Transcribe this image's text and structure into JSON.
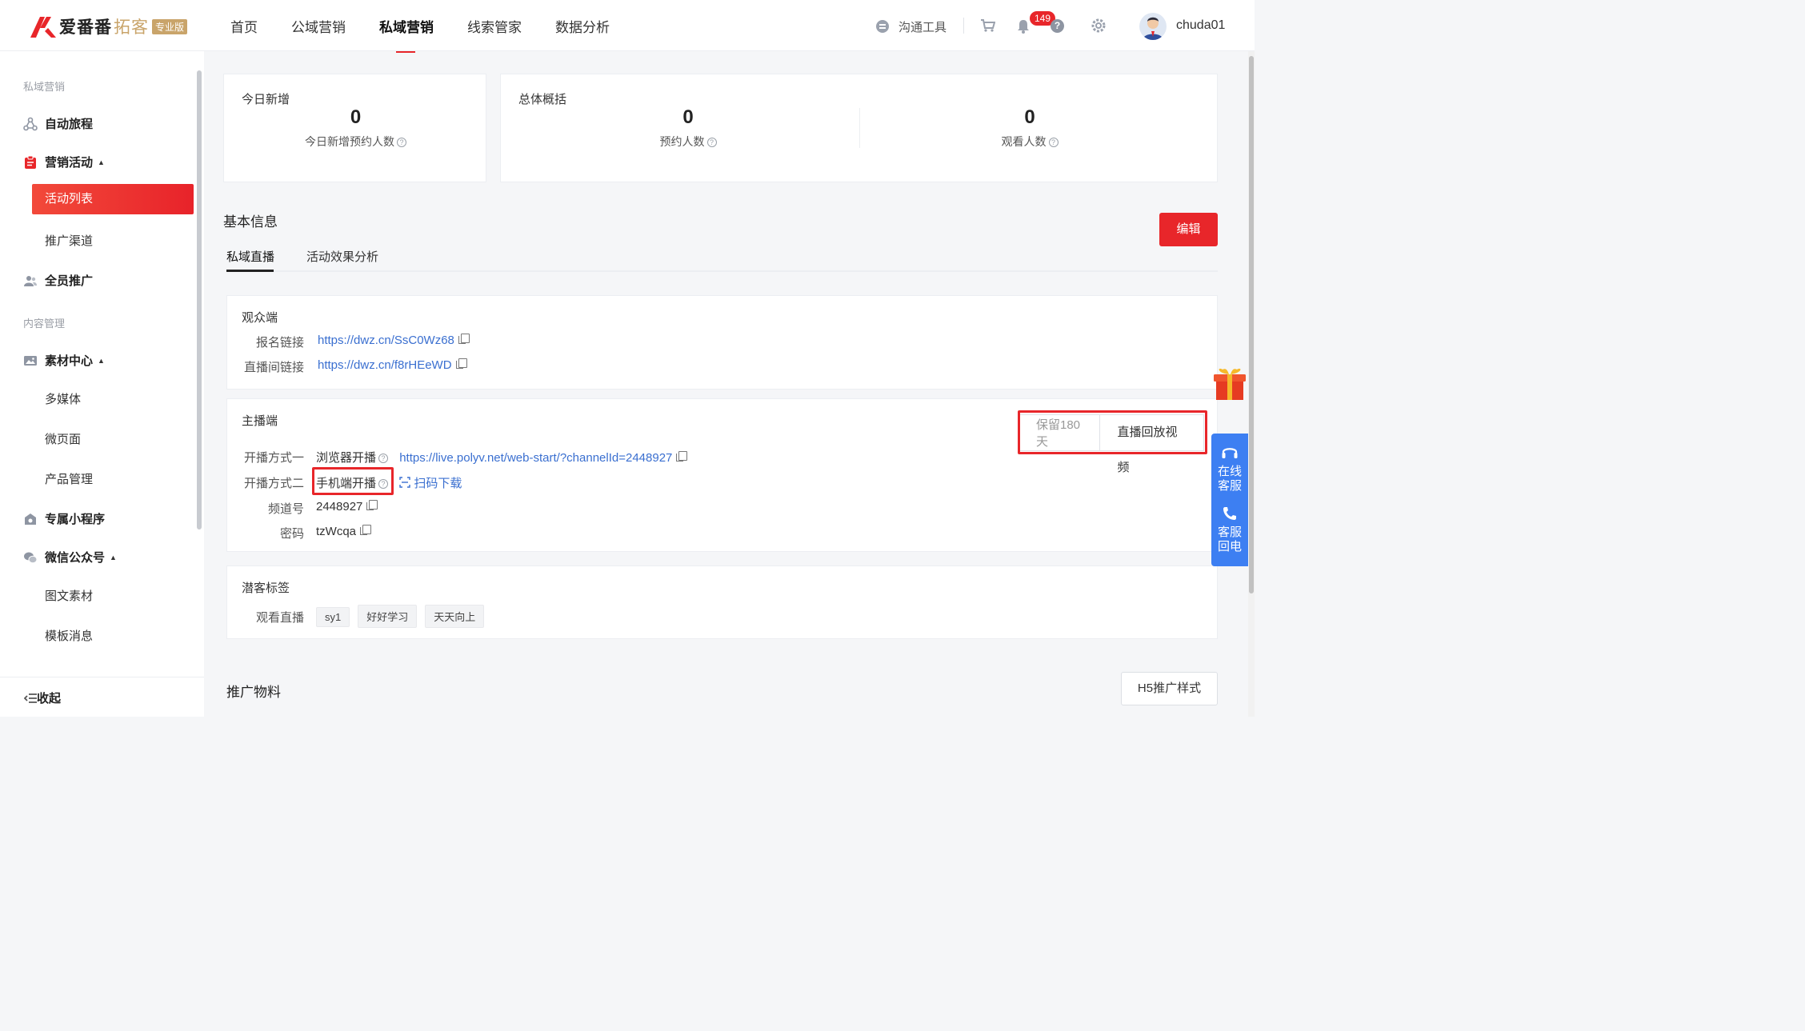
{
  "header": {
    "brand": "爱番番",
    "brand_sub": "拓客",
    "pro_badge": "专业版",
    "nav": [
      "首页",
      "公域营销",
      "私域营销",
      "线索管家",
      "数据分析"
    ],
    "active_nav": "私域营销",
    "tool_label": "沟通工具",
    "notification_count": "149",
    "username": "chuda01"
  },
  "sidebar": {
    "section_private": "私域营销",
    "auto_journey": "自动旅程",
    "marketing_activity": "营销活动",
    "activity_list": "活动列表",
    "promo_channel": "推广渠道",
    "all_staff": "全员推广",
    "section_content": "内容管理",
    "material_center": "素材中心",
    "multimedia": "多媒体",
    "micro_page": "微页面",
    "product_mgmt": "产品管理",
    "mini_program": "专属小程序",
    "wechat_official": "微信公众号",
    "article_material": "图文素材",
    "template_msg": "模板消息",
    "collapse": "收起"
  },
  "main": {
    "today_card": {
      "title": "今日新增",
      "value": "0",
      "label": "今日新增预约人数"
    },
    "overview_card": {
      "title": "总体概括",
      "reserve_value": "0",
      "reserve_label": "预约人数",
      "watch_value": "0",
      "watch_label": "观看人数"
    },
    "basic_info_title": "基本信息",
    "edit_label": "编辑",
    "tabs": [
      "私域直播",
      "活动效果分析"
    ],
    "audience": {
      "title": "观众端",
      "signup_label": "报名链接",
      "signup_url": "https://dwz.cn/SsC0Wz68",
      "room_label": "直播间链接",
      "room_url": "https://dwz.cn/f8rHEeWD"
    },
    "host": {
      "title": "主播端",
      "retain_label": "保留180天",
      "replay_label": "直播回放视频",
      "method1_label": "开播方式一",
      "method1_value": "浏览器开播",
      "method1_url": "https://live.polyv.net/web-start/?channelId=2448927",
      "method2_label": "开播方式二",
      "method2_value": "手机端开播",
      "scan_label": "扫码下载",
      "channel_label": "频道号",
      "channel_value": "2448927",
      "password_label": "密码",
      "password_value": "tzWcqa"
    },
    "tags": {
      "title": "潜客标签",
      "watch_label": "观看直播",
      "items": [
        "sy1",
        "好好学习",
        "天天向上"
      ]
    },
    "promo_title": "推广物料",
    "h5_label": "H5推广样式"
  },
  "float": {
    "online_service": "在线客服",
    "callback": "客服回电"
  },
  "colors": {
    "brand_red": "#e8262a",
    "link_blue": "#3a6fd0",
    "service_blue": "#3d7ff2"
  }
}
